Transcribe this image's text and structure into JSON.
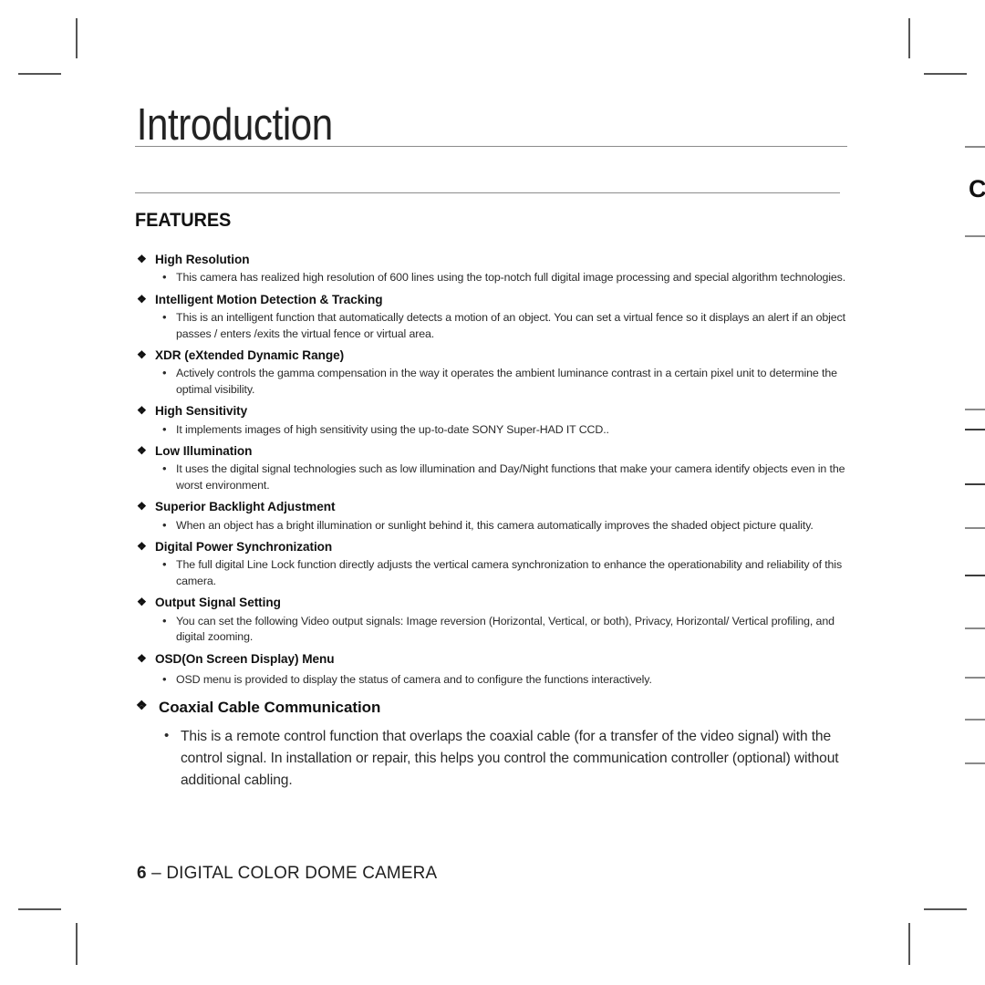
{
  "document": {
    "chapter_title": "Introduction",
    "section_heading": "FEATURES",
    "thumb_index_letter": "C"
  },
  "features": [
    {
      "title": "High Resolution",
      "body": "This camera has realized high resolution of 600 lines using the top-notch full digital image processing and special algorithm technologies."
    },
    {
      "title": "Intelligent Motion Detection & Tracking",
      "body": "This is an intelligent function that automatically detects a motion of an object. You can set a virtual fence so it displays an alert if an object passes / enters /exits the virtual fence or virtual area."
    },
    {
      "title": "XDR (eXtended Dynamic Range)",
      "body": "Actively controls the gamma compensation in the way it operates the ambient luminance contrast in a certain pixel unit to determine the optimal visibility."
    },
    {
      "title": "High Sensitivity",
      "body": "It implements images of high sensitivity using the up-to-date SONY Super-HAD IT CCD.."
    },
    {
      "title": "Low Illumination",
      "body": "It uses the digital signal technologies such as low illumination and Day/Night functions that make your camera identify objects even in the worst environment."
    },
    {
      "title": "Superior Backlight Adjustment",
      "body": "When an object has a bright illumination or sunlight behind it, this camera automatically improves the shaded object picture quality."
    },
    {
      "title": "Digital Power Synchronization",
      "body": "The full digital Line Lock function directly adjusts the vertical camera synchronization to enhance the operationability and reliability of this camera."
    },
    {
      "title": "Output Signal Setting",
      "body": "You can set the following Video output signals: Image reversion (Horizontal, Vertical, or both), Privacy, Horizontal/ Vertical profiling, and digital zooming."
    },
    {
      "title": "OSD(On Screen Display) Menu",
      "body": "OSD menu is provided to display the status of camera and to configure the functions interactively."
    },
    {
      "title": "Coaxial Cable Communication",
      "body": "This is a remote control function that overlaps the coaxial cable (for a transfer of the video signal) with the control signal. In installation or repair, this helps you control the communication controller (optional) without additional cabling."
    }
  ],
  "bullets": {
    "heading_marker": "❖",
    "body_marker": "•"
  },
  "footer": {
    "page_number": "6",
    "title": "– DIGITAL COLOR DOME CAMERA"
  },
  "colors": {
    "text": "#1a1a1a",
    "rule": "#8c8c8c",
    "crop_mark": "#555555",
    "edge_tick": "#8a8a8a"
  }
}
